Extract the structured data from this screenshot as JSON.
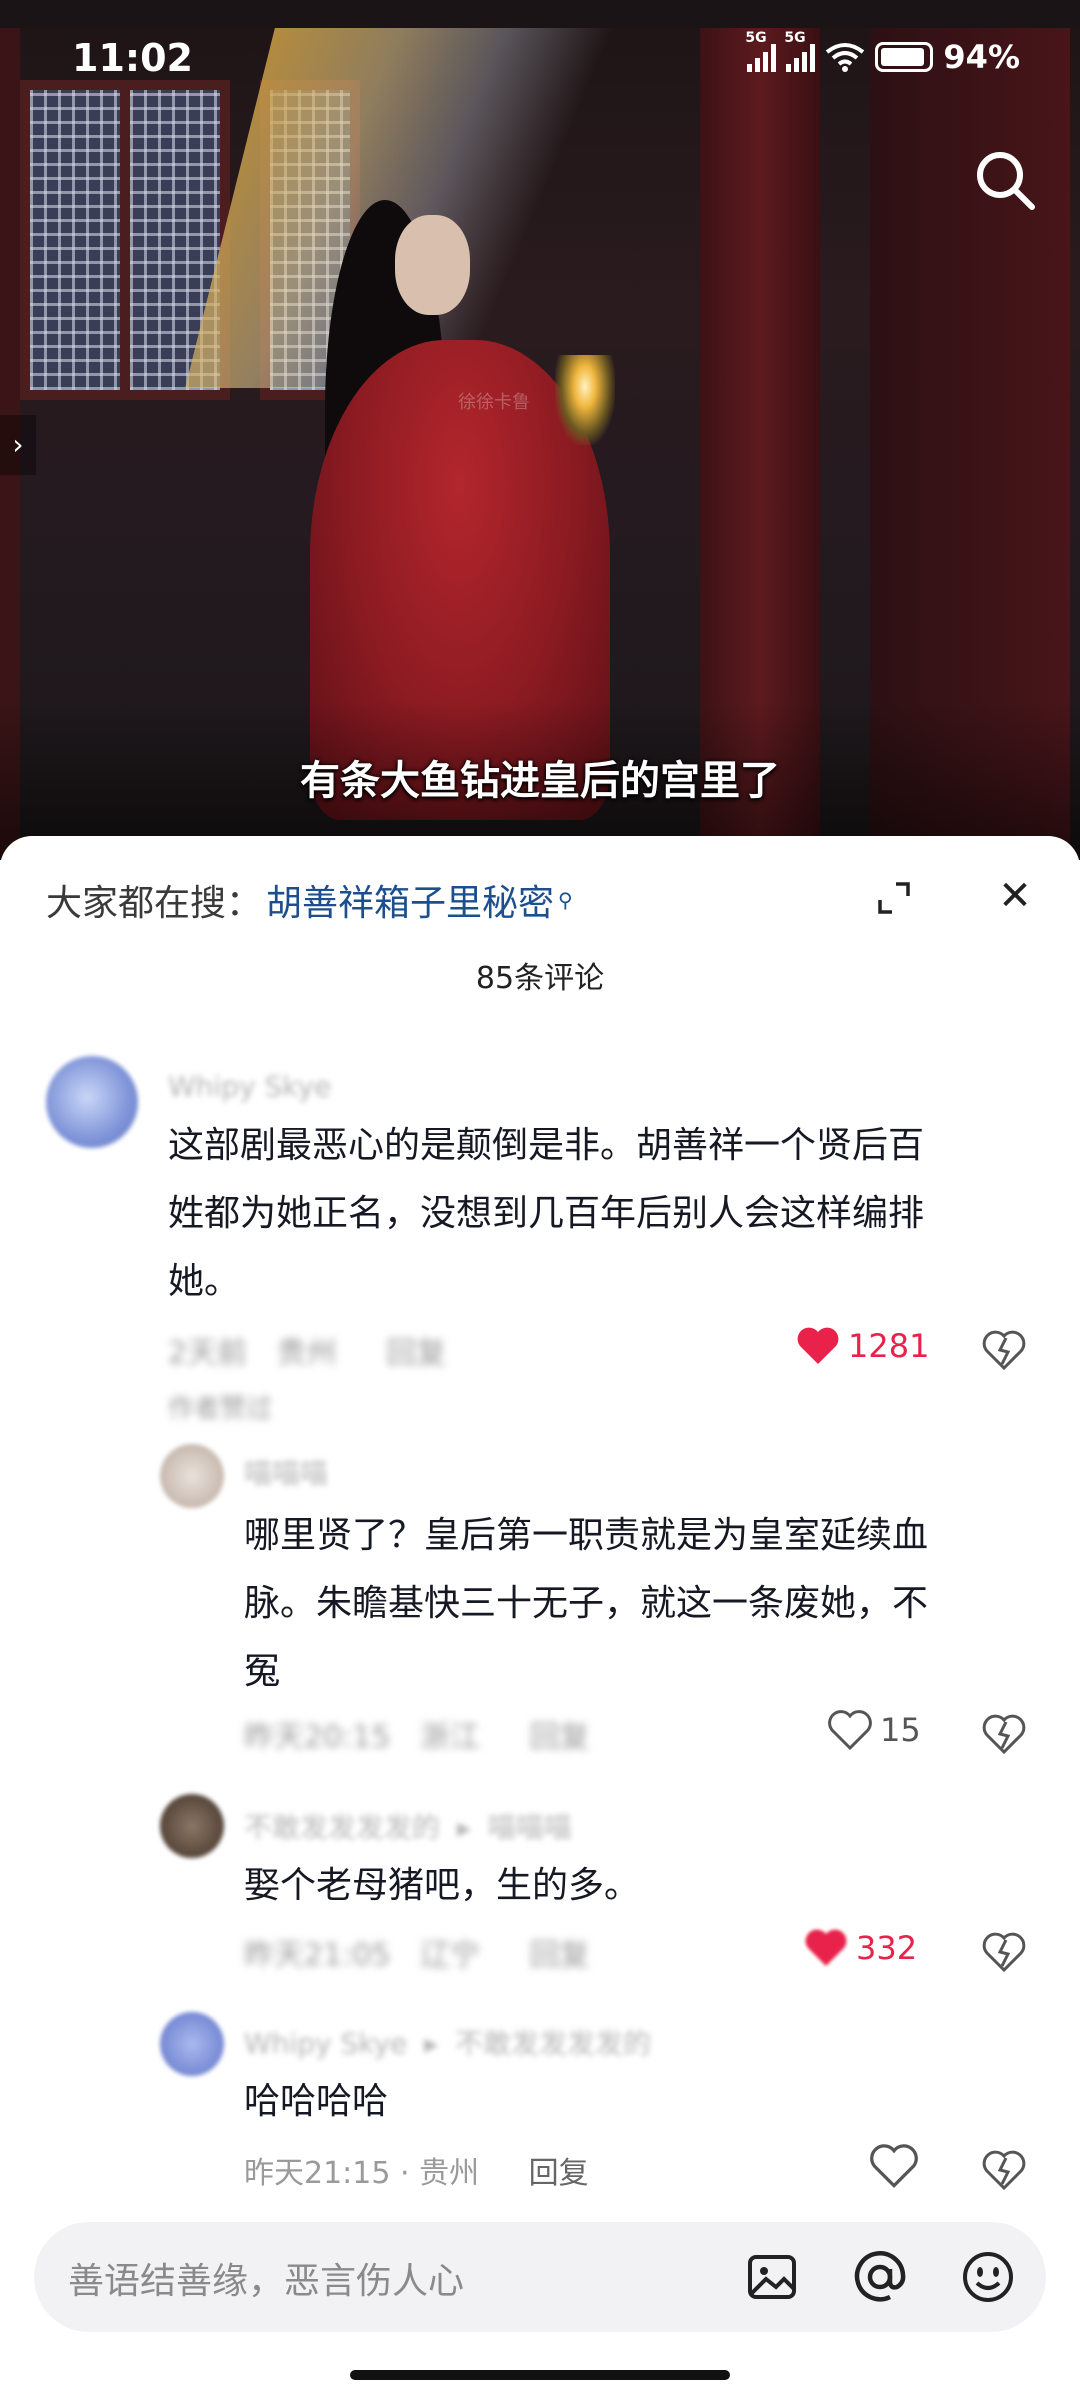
{
  "status_bar": {
    "time": "11:02",
    "net1": "5G",
    "net2": "5G",
    "battery": "94%"
  },
  "video": {
    "subtitle": "有条大鱼钻进皇后的宫里了",
    "watermark": "徐徐卡鲁",
    "side_arrow": "›"
  },
  "sheet": {
    "hot_label": "大家都在搜：",
    "hot_keyword": "胡善祥箱子里秘密",
    "comment_count": "85条评论",
    "input_placeholder": "善语结善缘，恶言伤人心"
  },
  "comments": [
    {
      "name": "Whipy Skye",
      "text_lines": [
        "这部剧最恶心的是颠倒是非。胡善祥一个贤后百",
        "姓都为她正名，没想到几百年后别人会这样编排",
        "她。"
      ],
      "time": "2天前",
      "location": "贵州",
      "reply": "回复",
      "likes": "1281",
      "liked_by_author": "作者赞过"
    },
    {
      "name": "喵喵喵",
      "text_lines": [
        "哪里贤了？皇后第一职责就是为皇室延续血",
        "脉。朱瞻基快三十无子，就这一条废她，不",
        "冤"
      ],
      "time": "昨天20:15",
      "location": "浙江",
      "reply": "回复",
      "likes": "15"
    },
    {
      "name": "不敢发发发发的",
      "reply_to": "喵喵喵",
      "text_lines": [
        "娶个老母猪吧，生的多。"
      ],
      "time": "昨天21:05",
      "location": "辽宁",
      "reply": "回复",
      "likes": "332"
    },
    {
      "name": "Whipy Skye",
      "reply_to": "不敢发发发发的",
      "text_lines": [
        "哈哈哈哈"
      ],
      "time": "昨天21:15",
      "location": "贵州",
      "reply": "回复",
      "likes": ""
    }
  ],
  "colors": {
    "like_red": "#e8224a",
    "keyword_blue": "#1d4f8f",
    "meta_gray": "#9a9a9a"
  },
  "icons": [
    "search-icon",
    "expand-icon",
    "close-icon",
    "heart-icon",
    "dislike-icon",
    "image-icon",
    "at-icon",
    "emoji-icon"
  ]
}
